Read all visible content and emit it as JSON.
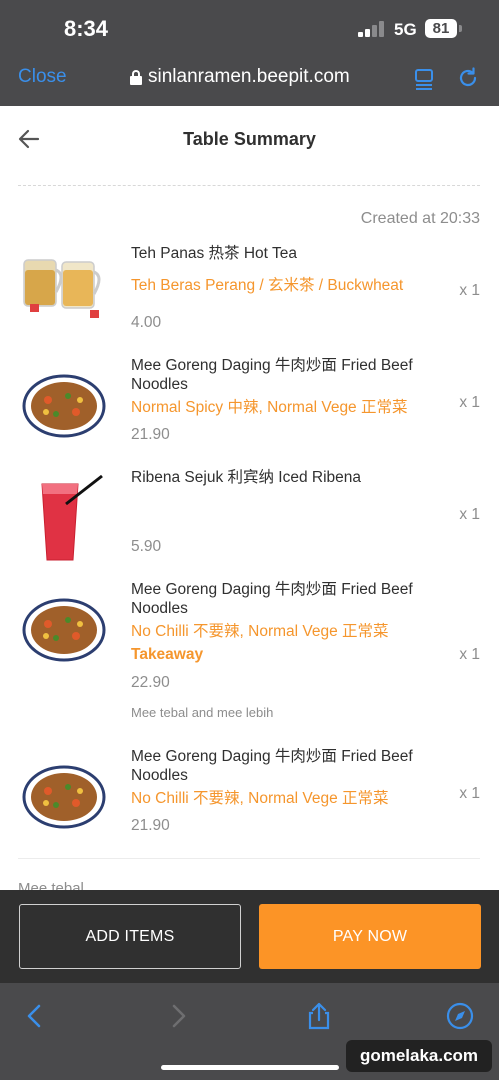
{
  "status_bar": {
    "time": "8:34",
    "network": "5G",
    "battery": "81"
  },
  "browser": {
    "close_label": "Close",
    "url": "sinlanramen.beepit.com"
  },
  "header": {
    "title": "Table Summary"
  },
  "order": {
    "created": "Created at 20:33"
  },
  "items": [
    {
      "name": "Teh Panas 热茶 Hot Tea",
      "options": "Teh Beras Perang / 玄米茶 / Buckwheat",
      "price": "4.00",
      "qty": "x 1",
      "image": "hot-tea-mugs"
    },
    {
      "name": "Mee Goreng Daging 牛肉炒面 Fried Beef Noodles",
      "options": "Normal Spicy 中辣, Normal Vege 正常菜",
      "price": "21.90",
      "qty": "x 1",
      "image": "fried-noodles-bowl"
    },
    {
      "name": "Ribena Sejuk 利宾纳 Iced Ribena",
      "options": "",
      "price": "5.90",
      "qty": "x 1",
      "image": "iced-ribena-glass"
    },
    {
      "name": "Mee Goreng Daging 牛肉炒面 Fried Beef Noodles",
      "options": "No Chilli 不要辣, Normal Vege 正常菜",
      "takeaway": "Takeaway",
      "price": "22.90",
      "note": "Mee tebal and mee lebih",
      "qty": "x 1",
      "image": "fried-noodles-bowl"
    },
    {
      "name": "Mee Goreng Daging 牛肉炒面 Fried Beef Noodles",
      "options": "No Chilli 不要辣, Normal Vege 正常菜",
      "price": "21.90",
      "qty": "x 1",
      "image": "fried-noodles-bowl"
    }
  ],
  "partial_note": "Mee tebal",
  "actions": {
    "add_items": "ADD ITEMS",
    "pay_now": "PAY NOW"
  },
  "watermark": "gomelaka.com",
  "colors": {
    "accent": "#fc9426",
    "option_text": "#f5962d",
    "browser_chrome": "#4a4a4c",
    "link_blue": "#3a8fea"
  }
}
